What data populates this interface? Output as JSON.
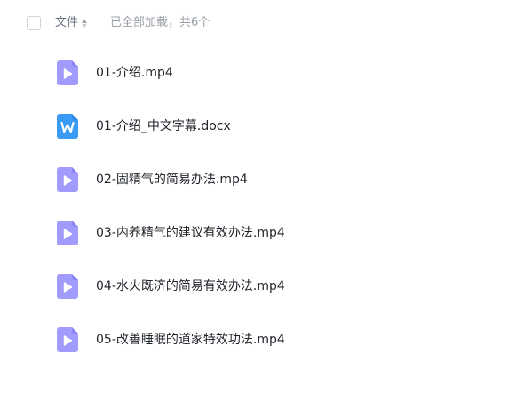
{
  "header": {
    "column_name": "文件",
    "load_status": "已全部加载，共6个"
  },
  "files": [
    {
      "name": "01-介绍.mp4",
      "type": "video",
      "icon": "video-file-icon"
    },
    {
      "name": "01-介绍_中文字幕.docx",
      "type": "word",
      "icon": "word-file-icon"
    },
    {
      "name": "02-固精气的简易办法.mp4",
      "type": "video",
      "icon": "video-file-icon"
    },
    {
      "name": "03-内养精气的建议有效办法.mp4",
      "type": "video",
      "icon": "video-file-icon"
    },
    {
      "name": "04-水火既济的简易有效办法.mp4",
      "type": "video",
      "icon": "video-file-icon"
    },
    {
      "name": "05-改善睡眠的道家特效功法.mp4",
      "type": "video",
      "icon": "video-file-icon"
    }
  ],
  "colors": {
    "video_icon": "#a29bfe",
    "video_icon_dark": "#8c84f5",
    "word_icon": "#3a9bf5",
    "word_icon_dark": "#2d85e0"
  }
}
